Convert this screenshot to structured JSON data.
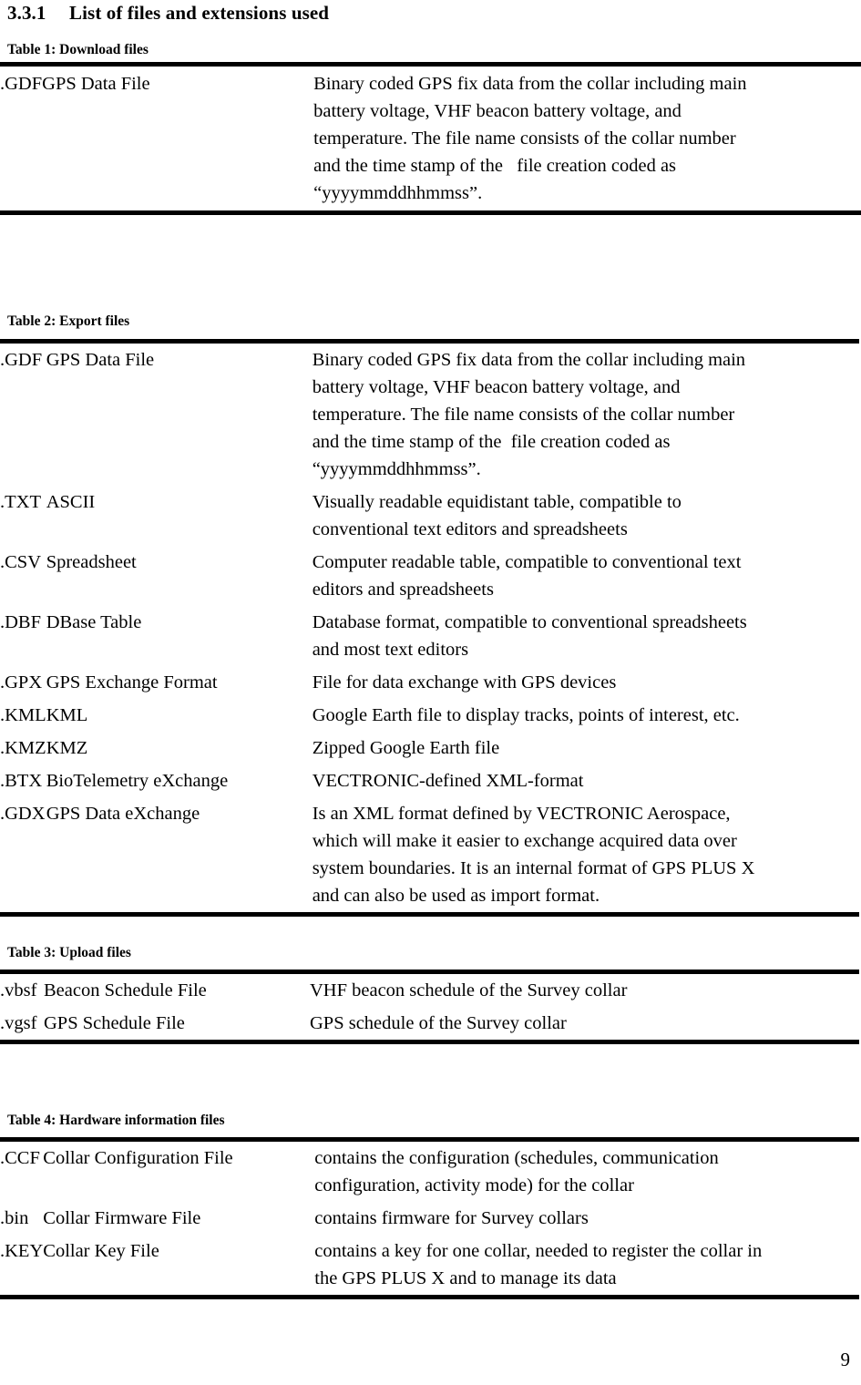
{
  "document": {
    "section": {
      "number": "3.3.1",
      "title": "List of files and extensions used"
    },
    "page_number": "9"
  },
  "tables": [
    {
      "caption": "Table 1: Download files",
      "rows": [
        {
          "extension": ".GDF",
          "name": "GPS Data File",
          "description": "Binary coded GPS fix data from the collar including main battery voltage, VHF beacon battery voltage, and temperature. The file name consists of the collar number and the time stamp of the  file creation coded as “yyyymmddhhmmss”.",
          "lines": [
            "Binary coded GPS fix data from the collar including main",
            "battery voltage, VHF beacon battery voltage, and",
            "temperature. The file name consists of the collar number",
            "and the time stamp of the   file creation coded as",
            "“yyyymmddhhmmss”."
          ]
        }
      ]
    },
    {
      "caption": "Table 2: Export files",
      "rows": [
        {
          "extension": ".GDF",
          "name": "GPS Data File",
          "description": "Binary coded GPS fix data from the collar including main battery voltage, VHF beacon battery voltage, and temperature. The file name consists of the collar number and the time stamp of the  file creation coded as “yyyymmddhhmmss”.",
          "lines": [
            "Binary coded GPS fix data from the collar including main",
            "battery voltage, VHF beacon battery voltage, and",
            "temperature. The file name consists of the collar number",
            "and the time stamp of the  file creation coded as",
            "“yyyymmddhhmmss”."
          ]
        },
        {
          "extension": ".TXT",
          "name": "ASCII",
          "description": "Visually readable equidistant table, compatible to conventional text editors and spreadsheets",
          "lines": [
            "Visually readable equidistant table, compatible to",
            "conventional text editors and spreadsheets"
          ]
        },
        {
          "extension": ".CSV",
          "name": "Spreadsheet",
          "description": "Computer readable table, compatible to conventional text editors and spreadsheets",
          "lines": [
            "Computer readable table, compatible to conventional text",
            "editors and spreadsheets"
          ]
        },
        {
          "extension": ".DBF",
          "name": "DBase Table",
          "description": "Database format, compatible to conventional spreadsheets and most text editors",
          "lines": [
            "Database format, compatible to conventional spreadsheets",
            "and most text editors"
          ]
        },
        {
          "extension": ".GPX",
          "name": "GPS Exchange Format",
          "description": "File for data exchange with GPS devices",
          "lines": [
            "File for data exchange with GPS devices"
          ]
        },
        {
          "extension": ".KML",
          "name": "KML",
          "description": "Google Earth file to display tracks, points of interest, etc.",
          "lines": [
            "Google Earth file to display tracks, points of interest, etc."
          ]
        },
        {
          "extension": ".KMZ",
          "name": "KMZ",
          "description": "Zipped Google Earth file",
          "lines": [
            "Zipped Google Earth file"
          ]
        },
        {
          "extension": ".BTX",
          "name": "BioTelemetry eXchange",
          "description": "VECTRONIC-defined XML-format",
          "lines": [
            "VECTRONIC-defined XML-format"
          ]
        },
        {
          "extension": ".GDX",
          "name": "GPS Data eXchange",
          "description": "Is an XML format defined by VECTRONIC Aerospace, which will make it easier to exchange acquired data over system boundaries. It is an internal format of GPS PLUS X and can also be used as import format.",
          "lines": [
            "Is an XML format defined by VECTRONIC Aerospace,",
            "which will make it easier to exchange acquired data over",
            "system boundaries. It is an internal format of GPS PLUS X",
            "and can also be used as import format."
          ]
        }
      ]
    },
    {
      "caption": "Table 3: Upload files",
      "rows": [
        {
          "extension": ".vbsf",
          "name": "Beacon Schedule File",
          "description": "VHF beacon schedule of the Survey collar",
          "lines": [
            "VHF beacon schedule of the Survey collar"
          ]
        },
        {
          "extension": ".vgsf",
          "name": "GPS Schedule File",
          "description": "GPS schedule of the Survey collar",
          "lines": [
            "GPS schedule of the Survey collar"
          ]
        }
      ]
    },
    {
      "caption": "Table 4: Hardware information files",
      "rows": [
        {
          "extension": ".CCF",
          "name": "Collar Configuration File",
          "description": "contains the configuration (schedules, communication configuration, activity mode) for the collar",
          "lines": [
            "contains the configuration (schedules, communication",
            "configuration, activity mode) for the collar"
          ]
        },
        {
          "extension": ".bin",
          "name": "Collar Firmware File",
          "description": "contains firmware for Survey collars",
          "lines": [
            "contains firmware for Survey collars"
          ]
        },
        {
          "extension": ".KEY",
          "name": "Collar Key File",
          "description": "contains a key for one collar, needed to register the collar in the GPS PLUS X and to manage its data",
          "lines": [
            "contains a key for one collar, needed to register the collar in",
            "the GPS PLUS X and to manage its data"
          ]
        }
      ]
    }
  ]
}
